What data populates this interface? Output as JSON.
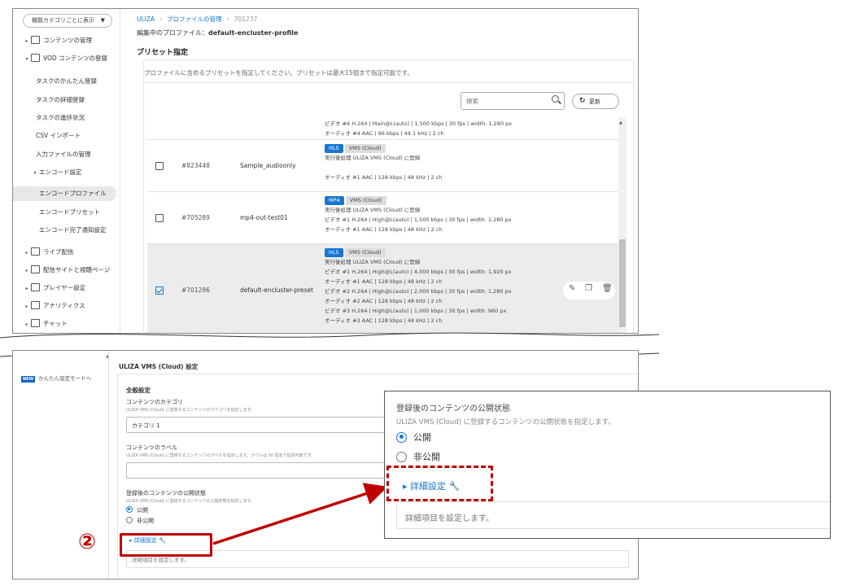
{
  "sidebar": {
    "view_button": "機能カテゴリごとに表示",
    "items": [
      {
        "label": "コンテンツの管理",
        "arrow": "▸",
        "icon": "content-icon"
      },
      {
        "label": "VOD コンテンツの登録",
        "arrow": "▾",
        "icon": "vod-icon"
      },
      {
        "label": "タスクのかんたん登録"
      },
      {
        "label": "タスクの詳細登録"
      },
      {
        "label": "タスクの進捗状況"
      },
      {
        "label": "CSV インポート"
      },
      {
        "label": "入力ファイルの管理"
      },
      {
        "label": "エンコード設定",
        "arrow": "▾"
      },
      {
        "label": "エンコードプロファイル"
      },
      {
        "label": "エンコードプリセット"
      },
      {
        "label": "エンコード完了通知設定"
      },
      {
        "label": "ライブ配信",
        "arrow": "▸",
        "icon": "live-icon"
      },
      {
        "label": "配信サイトと視聴ページ",
        "arrow": "▸",
        "icon": "site-icon"
      },
      {
        "label": "プレイヤー設定",
        "arrow": "▸",
        "icon": "player-icon"
      },
      {
        "label": "アナリティクス",
        "arrow": "▸",
        "icon": "analytics-icon"
      },
      {
        "label": "チャット",
        "arrow": "▸",
        "icon": "chat-icon"
      }
    ]
  },
  "breadcrumb": {
    "root": "ULIZA",
    "sep": "›",
    "profiles": "プロファイルの管理",
    "current": "701237"
  },
  "editing": {
    "prefix": "編集中のプロファイル：",
    "name": "default-encluster-profile"
  },
  "preset_section": {
    "title": "プリセット指定",
    "description": "プロファイルに含めるプリセットを指定してください。プリセットは最大15個まで指定可能です。",
    "search_placeholder": "検索",
    "refresh_label": "更新"
  },
  "presets": [
    {
      "partial": true,
      "lines": [
        "ビデオ #4  H.264 | Main@L(auto) | 1,500 kbps | 30 fps | width: 1,280 px",
        "オーディオ #4  AAC | 96 kbps | 44.1 kHz | 2 ch"
      ]
    },
    {
      "id": "#823448",
      "name": "Sample_audioonly",
      "checked": false,
      "badges": [
        "HLS",
        "VMS (Cloud)"
      ],
      "lines": [
        "実行後処理  ULIZA VMS (Cloud) に登録",
        "",
        "オーディオ #1  AAC | 128 kbps | 48 kHz | 2 ch"
      ]
    },
    {
      "id": "#705289",
      "name": "mp4-out-test01",
      "checked": false,
      "badges": [
        "MP4",
        "VMS (Cloud)"
      ],
      "lines": [
        "実行後処理  ULIZA VMS (Cloud) に登録",
        "ビデオ #1  H.264 | High@L(auto) | 1,500 kbps | 30 fps | width: 1,280 px",
        "オーディオ #1  AAC | 128 kbps | 48 kHz | 2 ch"
      ]
    },
    {
      "id": "#701286",
      "name": "default-encluster-preset",
      "checked": true,
      "badges": [
        "HLS",
        "VMS (Cloud)"
      ],
      "lines": [
        "実行後処理  ULIZA VMS (Cloud) に登録",
        "ビデオ #1  H.264 | High@L(auto) | 4,000 kbps | 30 fps | width: 1,920 px",
        "オーディオ #1  AAC | 128 kbps | 48 kHz | 2 ch",
        "ビデオ #2  H.264 | High@L(auto) | 2,000 kbps | 30 fps | width: 1,280 px",
        "オーディオ #2  AAC | 128 kbps | 48 kHz | 2 ch",
        "ビデオ #3  H.264 | High@L(auto) | 1,000 kbps | 30 fps | width: 960 px",
        "オーディオ #3  AAC | 128 kbps | 48 kHz | 2 ch"
      ],
      "actions": [
        "edit-icon",
        "copy-icon",
        "delete-icon"
      ]
    }
  ],
  "bottom": {
    "new_badge": "NEW",
    "new_link": "かんたん設定モードへ",
    "vms_title": "ULIZA VMS (Cloud) 設定",
    "general_heading": "全般設定",
    "category_label": "コンテンツのカテゴリ",
    "category_desc": "ULIZA VMS (Cloud) に登録するコンテンツのカテゴリを指定します。",
    "category_value": "カテゴリ 1",
    "tag_label": "コンテンツのラベル",
    "tag_desc": "ULIZA VMS (Cloud) に登録するコンテンツのラベルを指定します。ラベルは 50 個まで指定可能です。",
    "tag_value": "",
    "publish_label": "登録後のコンテンツの公開状態",
    "publish_desc": "ULIZA VMS (Cloud) に登録するコンテンツの公開状態を指定します。",
    "public_label": "公開",
    "private_label": "非公開",
    "detail_label": "詳細設定",
    "detail_hint": "詳細項目を設定します。"
  },
  "callout": {
    "number": "②"
  },
  "colors": {
    "accent": "#1976d2",
    "highlight": "#c00000"
  }
}
